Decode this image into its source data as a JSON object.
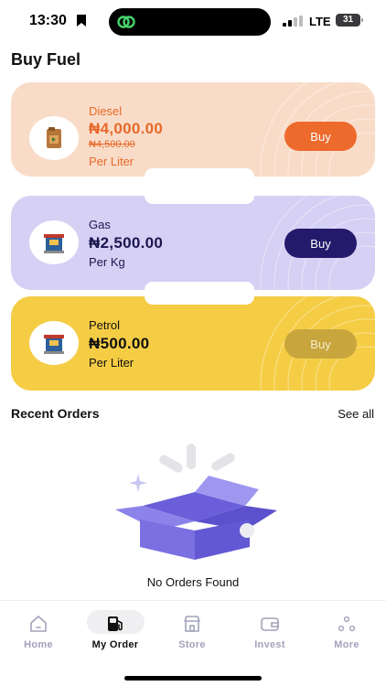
{
  "status_bar": {
    "time": "13:30",
    "network": "LTE",
    "battery": "31"
  },
  "page": {
    "title": "Buy Fuel"
  },
  "products": [
    {
      "name": "Diesel",
      "price": "₦4,000.00",
      "old_price": "₦4,500.00",
      "unit": "Per Liter",
      "button": "Buy",
      "thumb_icon": "jerrycan-icon",
      "color": "#e6692a"
    },
    {
      "name": "Gas",
      "price": "₦2,500.00",
      "unit": "Per Kg",
      "button": "Buy",
      "thumb_icon": "fuel-pump-icon",
      "color": "#231a6b"
    },
    {
      "name": "Petrol",
      "price": "₦500.00",
      "unit": "Per Liter",
      "button": "Buy",
      "thumb_icon": "fuel-pump-icon",
      "color": "#c9a53d"
    }
  ],
  "recent_orders": {
    "title": "Recent Orders",
    "see_all": "See all",
    "empty_text": "No Orders Found",
    "empty_icon": "open-box-icon"
  },
  "nav": {
    "items": [
      {
        "label": "Home",
        "icon": "home-icon"
      },
      {
        "label": "My Order",
        "icon": "fuel-pump-icon",
        "active": true
      },
      {
        "label": "Store",
        "icon": "store-icon"
      },
      {
        "label": "Invest",
        "icon": "wallet-icon"
      },
      {
        "label": "More",
        "icon": "more-dots-icon"
      }
    ]
  },
  "colors": {
    "accent_orange": "#ec6a2c",
    "accent_navy": "#231a6b",
    "accent_yellow": "#f5cd45",
    "nav_inactive": "#a2a2ba"
  }
}
